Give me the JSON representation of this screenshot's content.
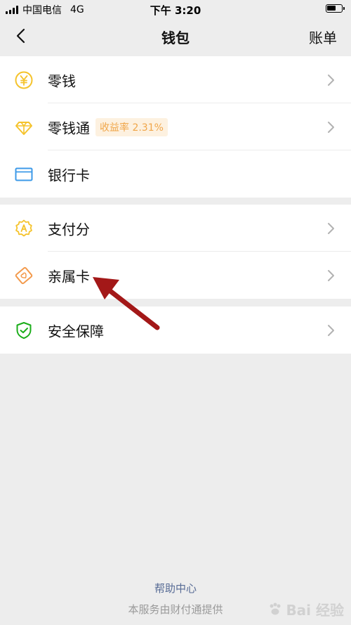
{
  "status_bar": {
    "carrier": "中国电信",
    "network": "4G",
    "time": "下午 3:20"
  },
  "nav": {
    "title": "钱包",
    "right_label": "账单"
  },
  "groups": [
    {
      "items": [
        {
          "label": "零钱",
          "icon": "coin-yuan-icon"
        },
        {
          "label": "零钱通",
          "icon": "diamond-icon",
          "badge": "收益率 2.31%"
        },
        {
          "label": "银行卡",
          "icon": "bank-card-icon"
        }
      ]
    },
    {
      "items": [
        {
          "label": "支付分",
          "icon": "payscore-badge-icon"
        },
        {
          "label": "亲属卡",
          "icon": "family-card-icon"
        }
      ]
    },
    {
      "items": [
        {
          "label": "安全保障",
          "icon": "shield-check-icon"
        }
      ]
    }
  ],
  "footer": {
    "help": "帮助中心",
    "provider": "本服务由财付通提供"
  },
  "watermark": "Bai 经验",
  "colors": {
    "background": "#ededed",
    "link": "#576b95",
    "badge_text": "#f0a64a",
    "icon_yellow": "#f5c32c",
    "icon_orange": "#f39a4c",
    "icon_blue": "#3d9ae8",
    "icon_green": "#1aad19",
    "annotation_arrow": "#a31818"
  }
}
